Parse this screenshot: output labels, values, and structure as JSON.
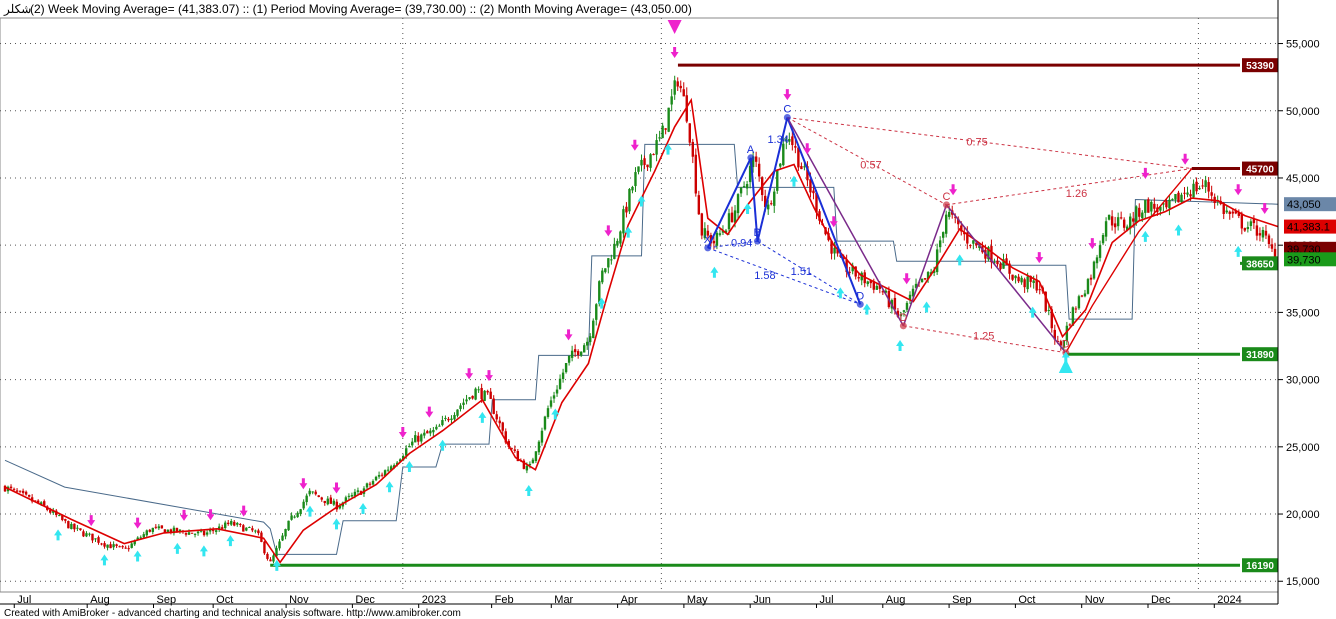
{
  "header": {
    "symbol": "شکلر",
    "legend_text": "(2) Week Moving Average= (41,383.07) :: (1) Period Moving Average= (39,730.00) :: (2) Month Moving Average= (43,050.00)"
  },
  "footer": {
    "text": "Created with AmiBroker - advanced charting and technical analysis software. http://www.amibroker.com"
  },
  "colors": {
    "candle_up": "#1a8a1a",
    "candle_down": "#cc0000",
    "week_ma": "#dd0000",
    "month_ma": "#4a6a8a",
    "harmonic_blue": "#1a2fd6",
    "harmonic_purple": "#7a2a8a",
    "fib_dashed": "#cc3344",
    "resistance": "#7a0000",
    "support": "#1a8a1a",
    "buy_arrow": "#33e6f0",
    "sell_arrow": "#ee22cc"
  },
  "chart_data": {
    "type": "line",
    "title": "",
    "xlabel": "",
    "ylabel": "",
    "ylim": [
      14200,
      56900
    ],
    "y_ticks": [
      15000,
      20000,
      25000,
      30000,
      35000,
      40000,
      45000,
      50000,
      55000
    ],
    "y_tick_labels": [
      "15,000",
      "20,000",
      "25,000",
      "30,000",
      "35,000",
      "40,000",
      "45,000",
      "50,000",
      "55,000"
    ],
    "x_labels": [
      {
        "m": 0.2,
        "label": "Jul"
      },
      {
        "m": 1.3,
        "label": "Aug"
      },
      {
        "m": 2.3,
        "label": "Sep"
      },
      {
        "m": 3.2,
        "label": "Oct"
      },
      {
        "m": 4.3,
        "label": "Nov"
      },
      {
        "m": 5.3,
        "label": "Dec"
      },
      {
        "m": 6.3,
        "label": "2023"
      },
      {
        "m": 7.4,
        "label": "Feb"
      },
      {
        "m": 8.3,
        "label": "Mar"
      },
      {
        "m": 9.3,
        "label": "Apr"
      },
      {
        "m": 10.3,
        "label": "May"
      },
      {
        "m": 11.3,
        "label": "Jun"
      },
      {
        "m": 12.3,
        "label": "Jul"
      },
      {
        "m": 13.3,
        "label": "Aug"
      },
      {
        "m": 14.3,
        "label": "Sep"
      },
      {
        "m": 15.3,
        "label": "Oct"
      },
      {
        "m": 16.3,
        "label": "Nov"
      },
      {
        "m": 17.3,
        "label": "Dec"
      },
      {
        "m": 18.3,
        "label": "2024"
      }
    ],
    "price_anchors": [
      [
        0,
        22000
      ],
      [
        0.6,
        20500
      ],
      [
        1.0,
        19000
      ],
      [
        1.5,
        17800
      ],
      [
        1.8,
        17300
      ],
      [
        2.2,
        18900
      ],
      [
        2.6,
        18700
      ],
      [
        3.0,
        18500
      ],
      [
        3.4,
        19300
      ],
      [
        3.8,
        18600
      ],
      [
        4.0,
        16300
      ],
      [
        4.3,
        19500
      ],
      [
        4.6,
        21600
      ],
      [
        5.0,
        20600
      ],
      [
        5.4,
        21800
      ],
      [
        5.8,
        23500
      ],
      [
        6.2,
        25600
      ],
      [
        6.5,
        26200
      ],
      [
        6.8,
        27800
      ],
      [
        7.1,
        29200
      ],
      [
        7.3,
        28600
      ],
      [
        7.6,
        25000
      ],
      [
        7.9,
        23200
      ],
      [
        8.2,
        28000
      ],
      [
        8.5,
        31500
      ],
      [
        8.8,
        33000
      ],
      [
        9.0,
        37800
      ],
      [
        9.2,
        40000
      ],
      [
        9.5,
        45000
      ],
      [
        9.9,
        48000
      ],
      [
        10.15,
        52500
      ],
      [
        10.3,
        49500
      ],
      [
        10.5,
        41000
      ],
      [
        10.7,
        40200
      ],
      [
        11.0,
        42500
      ],
      [
        11.3,
        46500
      ],
      [
        11.5,
        42500
      ],
      [
        11.8,
        48600
      ],
      [
        12.0,
        46000
      ],
      [
        12.2,
        43500
      ],
      [
        12.4,
        40500
      ],
      [
        12.6,
        38600
      ],
      [
        12.9,
        37600
      ],
      [
        13.2,
        36800
      ],
      [
        13.5,
        34500
      ],
      [
        13.7,
        36500
      ],
      [
        14.0,
        38000
      ],
      [
        14.2,
        42500
      ],
      [
        14.5,
        40500
      ],
      [
        14.8,
        39500
      ],
      [
        15.0,
        38800
      ],
      [
        15.3,
        37300
      ],
      [
        15.6,
        37000
      ],
      [
        15.9,
        32200
      ],
      [
        16.1,
        35000
      ],
      [
        16.4,
        38000
      ],
      [
        16.6,
        42000
      ],
      [
        16.9,
        41500
      ],
      [
        17.2,
        43000
      ],
      [
        17.5,
        42500
      ],
      [
        17.8,
        44000
      ],
      [
        18.1,
        44500
      ],
      [
        18.4,
        42500
      ],
      [
        18.7,
        41500
      ],
      [
        18.95,
        41000
      ],
      [
        19.1,
        39500
      ],
      [
        19.2,
        39730
      ]
    ],
    "series": [
      {
        "name": "Week Moving Average",
        "values": [
          [
            0,
            22000
          ],
          [
            1.0,
            19600
          ],
          [
            1.8,
            17800
          ],
          [
            2.4,
            18600
          ],
          [
            3.2,
            18900
          ],
          [
            3.9,
            18200
          ],
          [
            4.15,
            16400
          ],
          [
            4.5,
            18800
          ],
          [
            5.0,
            20500
          ],
          [
            5.6,
            22200
          ],
          [
            6.1,
            24500
          ],
          [
            6.6,
            26200
          ],
          [
            7.2,
            28500
          ],
          [
            7.7,
            24200
          ],
          [
            8.0,
            23300
          ],
          [
            8.4,
            28300
          ],
          [
            8.8,
            31200
          ],
          [
            9.1,
            36500
          ],
          [
            9.4,
            41500
          ],
          [
            9.8,
            45500
          ],
          [
            10.1,
            48800
          ],
          [
            10.35,
            50800
          ],
          [
            10.6,
            42000
          ],
          [
            10.9,
            40800
          ],
          [
            11.2,
            43000
          ],
          [
            11.6,
            45500
          ],
          [
            11.9,
            46000
          ],
          [
            12.2,
            42800
          ],
          [
            12.5,
            40000
          ],
          [
            12.9,
            37800
          ],
          [
            13.3,
            36800
          ],
          [
            13.7,
            35800
          ],
          [
            14.1,
            38800
          ],
          [
            14.4,
            41200
          ],
          [
            14.8,
            39800
          ],
          [
            15.2,
            38300
          ],
          [
            15.6,
            37300
          ],
          [
            15.95,
            33200
          ],
          [
            16.3,
            35200
          ],
          [
            16.7,
            40200
          ],
          [
            17.1,
            41800
          ],
          [
            17.5,
            42500
          ],
          [
            17.9,
            43500
          ],
          [
            18.3,
            43300
          ],
          [
            18.7,
            42200
          ],
          [
            19.2,
            41383
          ]
        ]
      },
      {
        "name": "Month Moving Average",
        "values": [
          [
            0,
            24000
          ],
          [
            0.9,
            22000
          ],
          [
            3.9,
            19400
          ],
          [
            4.0,
            18900
          ],
          [
            4.1,
            17000
          ],
          [
            5.0,
            17000
          ],
          [
            5.1,
            19500
          ],
          [
            5.9,
            19500
          ],
          [
            6.0,
            23500
          ],
          [
            6.5,
            23500
          ],
          [
            6.6,
            25200
          ],
          [
            7.3,
            25200
          ],
          [
            7.35,
            28500
          ],
          [
            8.0,
            28500
          ],
          [
            8.05,
            31800
          ],
          [
            8.8,
            31800
          ],
          [
            8.85,
            39200
          ],
          [
            9.6,
            39200
          ],
          [
            9.65,
            47500
          ],
          [
            11.0,
            47500
          ],
          [
            11.05,
            44300
          ],
          [
            12.5,
            44300
          ],
          [
            12.55,
            40300
          ],
          [
            13.4,
            40300
          ],
          [
            13.45,
            38800
          ],
          [
            15.0,
            38800
          ],
          [
            15.05,
            38500
          ],
          [
            16.0,
            38500
          ],
          [
            16.05,
            34500
          ],
          [
            17.0,
            34500
          ],
          [
            17.05,
            43400
          ],
          [
            19.2,
            43050
          ]
        ]
      }
    ],
    "harmonic_points": [
      {
        "label": "X",
        "m": 10.6,
        "v": 39800
      },
      {
        "label": "A",
        "m": 11.25,
        "v": 46500
      },
      {
        "label": "B",
        "m": 11.35,
        "v": 40300
      },
      {
        "label": "C",
        "m": 11.8,
        "v": 49500
      },
      {
        "label": "D",
        "m": 12.9,
        "v": 35600
      },
      {
        "label": "D",
        "m": 13.55,
        "v": 34000
      },
      {
        "label": "C",
        "m": 14.2,
        "v": 43000
      },
      {
        "label": "D",
        "m": 16.0,
        "v": 32000
      }
    ],
    "ratio_labels": [
      {
        "text": "1.34",
        "m": 11.5,
        "v": 47600,
        "color": "blue"
      },
      {
        "text": "0.94",
        "m": 10.95,
        "v": 39900,
        "color": "blue"
      },
      {
        "text": "1.58",
        "m": 11.3,
        "v": 37500,
        "color": "blue"
      },
      {
        "text": "1.51",
        "m": 11.85,
        "v": 37800,
        "color": "blue"
      },
      {
        "text": "0.57",
        "m": 12.9,
        "v": 45700,
        "color": "red"
      },
      {
        "text": "0.75",
        "m": 14.5,
        "v": 47400,
        "color": "red"
      },
      {
        "text": "1.26",
        "m": 16.0,
        "v": 43600,
        "color": "red"
      },
      {
        "text": "1.25",
        "m": 14.6,
        "v": 33000,
        "color": "red"
      }
    ],
    "levels": [
      {
        "value": 53390,
        "label": "53390",
        "from_m": 10.15,
        "color": "#7a0000"
      },
      {
        "value": 45700,
        "label": "45700",
        "from_m": 17.9,
        "color": "#7a0000"
      },
      {
        "value": 38650,
        "label": "38650",
        "from_m": 19.1,
        "color": "#1a8a1a"
      },
      {
        "value": 31890,
        "label": "31890",
        "from_m": 16.0,
        "color": "#1a8a1a"
      },
      {
        "value": 16190,
        "label": "16190",
        "from_m": 4.0,
        "color": "#1a8a1a"
      }
    ],
    "right_labels": [
      {
        "value": 43050,
        "label": "43,050",
        "bg": "#6b87a8"
      },
      {
        "value": 41383,
        "label": "41,383.1",
        "bg": "#dd0000"
      },
      {
        "value": 39730,
        "label": "39,730",
        "bg": "#7a0000"
      },
      {
        "value": 38950,
        "label": "39,730",
        "bg": "#1a9a1a"
      }
    ],
    "buy_signals_m": [
      0.8,
      1.5,
      2.0,
      2.6,
      3.0,
      3.4,
      4.1,
      4.6,
      5.0,
      5.4,
      5.8,
      6.1,
      6.6,
      7.2,
      7.9,
      8.3,
      9.0,
      9.4,
      9.6,
      10.0,
      10.7,
      11.2,
      11.9,
      12.6,
      13.0,
      13.5,
      13.9,
      14.4,
      15.5,
      16.0,
      17.2,
      17.7,
      18.6
    ],
    "sell_signals_m": [
      1.3,
      2.0,
      2.7,
      3.1,
      3.6,
      4.5,
      5.0,
      6.0,
      6.4,
      7.0,
      7.3,
      8.5,
      9.1,
      9.5,
      10.1,
      11.8,
      12.1,
      12.5,
      13.6,
      14.3,
      15.6,
      16.4,
      17.2,
      17.8,
      18.6,
      19.0
    ]
  }
}
